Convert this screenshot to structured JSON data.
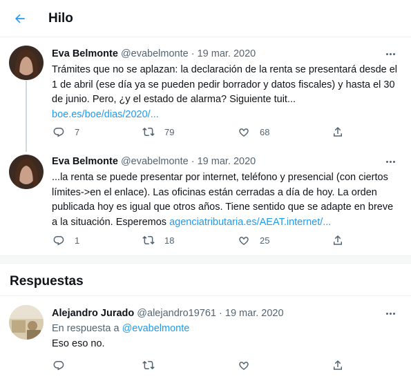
{
  "header": {
    "title": "Hilo"
  },
  "thread": [
    {
      "name": "Eva Belmonte",
      "handle": "@evabelmonte",
      "separator": "·",
      "date": "19 mar. 2020",
      "lines": [
        "Trámites que no se aplazan: la declaración de la renta se presentará desde el",
        "1 de abril (ese día ya se pueden pedir borrador y datos fiscales) y hasta el 30",
        "de junio. Pero, ¿y el estado de alarma? Siguiente tuit..."
      ],
      "link": "boe.es/boe/dias/2020/...",
      "replies": "7",
      "retweets": "79",
      "likes": "68"
    },
    {
      "name": "Eva Belmonte",
      "handle": "@evabelmonte",
      "separator": "·",
      "date": "19 mar. 2020",
      "lines": [
        "...la renta se puede presentar por internet, teléfono y presencial (con ciertos",
        "límites->en el enlace). Las oficinas están cerradas a día de hoy. La orden",
        "publicada hoy es igual que otros años. Tiene sentido que se adapte en breve"
      ],
      "last_line": "a la situación. Esperemos",
      "link": "agenciatributaria.es/AEAT.internet/...",
      "replies": "1",
      "retweets": "18",
      "likes": "25"
    }
  ],
  "replies_section": {
    "title": "Respuestas"
  },
  "reply": {
    "name": "Alejandro Jurado",
    "handle": "@alejandro19761",
    "separator": "·",
    "date": "19 mar. 2020",
    "in_reply_prefix": "En respuesta a",
    "in_reply_handle": "@evabelmonte",
    "text": "Eso eso no."
  },
  "colors": {
    "accent": "#1d9bf0",
    "secondary_text": "#536471",
    "border": "#eff3f4"
  },
  "icons": {
    "back": "arrow-left-icon",
    "more": "more-dots-icon",
    "reply": "reply-icon",
    "retweet": "retweet-icon",
    "like": "heart-icon",
    "share": "share-icon"
  }
}
